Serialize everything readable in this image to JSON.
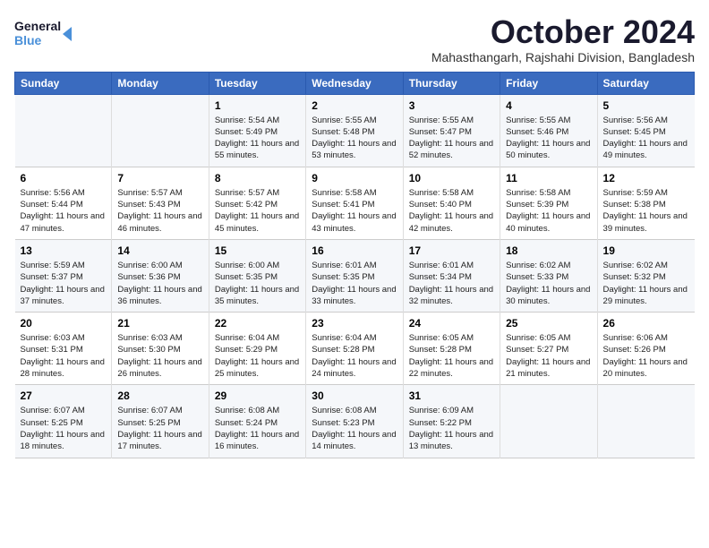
{
  "logo": {
    "line1": "General",
    "line2": "Blue"
  },
  "title": "October 2024",
  "subtitle": "Mahasthangarh, Rajshahi Division, Bangladesh",
  "headers": [
    "Sunday",
    "Monday",
    "Tuesday",
    "Wednesday",
    "Thursday",
    "Friday",
    "Saturday"
  ],
  "weeks": [
    [
      {
        "day": "",
        "text": ""
      },
      {
        "day": "",
        "text": ""
      },
      {
        "day": "1",
        "text": "Sunrise: 5:54 AM\nSunset: 5:49 PM\nDaylight: 11 hours and 55 minutes."
      },
      {
        "day": "2",
        "text": "Sunrise: 5:55 AM\nSunset: 5:48 PM\nDaylight: 11 hours and 53 minutes."
      },
      {
        "day": "3",
        "text": "Sunrise: 5:55 AM\nSunset: 5:47 PM\nDaylight: 11 hours and 52 minutes."
      },
      {
        "day": "4",
        "text": "Sunrise: 5:55 AM\nSunset: 5:46 PM\nDaylight: 11 hours and 50 minutes."
      },
      {
        "day": "5",
        "text": "Sunrise: 5:56 AM\nSunset: 5:45 PM\nDaylight: 11 hours and 49 minutes."
      }
    ],
    [
      {
        "day": "6",
        "text": "Sunrise: 5:56 AM\nSunset: 5:44 PM\nDaylight: 11 hours and 47 minutes."
      },
      {
        "day": "7",
        "text": "Sunrise: 5:57 AM\nSunset: 5:43 PM\nDaylight: 11 hours and 46 minutes."
      },
      {
        "day": "8",
        "text": "Sunrise: 5:57 AM\nSunset: 5:42 PM\nDaylight: 11 hours and 45 minutes."
      },
      {
        "day": "9",
        "text": "Sunrise: 5:58 AM\nSunset: 5:41 PM\nDaylight: 11 hours and 43 minutes."
      },
      {
        "day": "10",
        "text": "Sunrise: 5:58 AM\nSunset: 5:40 PM\nDaylight: 11 hours and 42 minutes."
      },
      {
        "day": "11",
        "text": "Sunrise: 5:58 AM\nSunset: 5:39 PM\nDaylight: 11 hours and 40 minutes."
      },
      {
        "day": "12",
        "text": "Sunrise: 5:59 AM\nSunset: 5:38 PM\nDaylight: 11 hours and 39 minutes."
      }
    ],
    [
      {
        "day": "13",
        "text": "Sunrise: 5:59 AM\nSunset: 5:37 PM\nDaylight: 11 hours and 37 minutes."
      },
      {
        "day": "14",
        "text": "Sunrise: 6:00 AM\nSunset: 5:36 PM\nDaylight: 11 hours and 36 minutes."
      },
      {
        "day": "15",
        "text": "Sunrise: 6:00 AM\nSunset: 5:35 PM\nDaylight: 11 hours and 35 minutes."
      },
      {
        "day": "16",
        "text": "Sunrise: 6:01 AM\nSunset: 5:35 PM\nDaylight: 11 hours and 33 minutes."
      },
      {
        "day": "17",
        "text": "Sunrise: 6:01 AM\nSunset: 5:34 PM\nDaylight: 11 hours and 32 minutes."
      },
      {
        "day": "18",
        "text": "Sunrise: 6:02 AM\nSunset: 5:33 PM\nDaylight: 11 hours and 30 minutes."
      },
      {
        "day": "19",
        "text": "Sunrise: 6:02 AM\nSunset: 5:32 PM\nDaylight: 11 hours and 29 minutes."
      }
    ],
    [
      {
        "day": "20",
        "text": "Sunrise: 6:03 AM\nSunset: 5:31 PM\nDaylight: 11 hours and 28 minutes."
      },
      {
        "day": "21",
        "text": "Sunrise: 6:03 AM\nSunset: 5:30 PM\nDaylight: 11 hours and 26 minutes."
      },
      {
        "day": "22",
        "text": "Sunrise: 6:04 AM\nSunset: 5:29 PM\nDaylight: 11 hours and 25 minutes."
      },
      {
        "day": "23",
        "text": "Sunrise: 6:04 AM\nSunset: 5:28 PM\nDaylight: 11 hours and 24 minutes."
      },
      {
        "day": "24",
        "text": "Sunrise: 6:05 AM\nSunset: 5:28 PM\nDaylight: 11 hours and 22 minutes."
      },
      {
        "day": "25",
        "text": "Sunrise: 6:05 AM\nSunset: 5:27 PM\nDaylight: 11 hours and 21 minutes."
      },
      {
        "day": "26",
        "text": "Sunrise: 6:06 AM\nSunset: 5:26 PM\nDaylight: 11 hours and 20 minutes."
      }
    ],
    [
      {
        "day": "27",
        "text": "Sunrise: 6:07 AM\nSunset: 5:25 PM\nDaylight: 11 hours and 18 minutes."
      },
      {
        "day": "28",
        "text": "Sunrise: 6:07 AM\nSunset: 5:25 PM\nDaylight: 11 hours and 17 minutes."
      },
      {
        "day": "29",
        "text": "Sunrise: 6:08 AM\nSunset: 5:24 PM\nDaylight: 11 hours and 16 minutes."
      },
      {
        "day": "30",
        "text": "Sunrise: 6:08 AM\nSunset: 5:23 PM\nDaylight: 11 hours and 14 minutes."
      },
      {
        "day": "31",
        "text": "Sunrise: 6:09 AM\nSunset: 5:22 PM\nDaylight: 11 hours and 13 minutes."
      },
      {
        "day": "",
        "text": ""
      },
      {
        "day": "",
        "text": ""
      }
    ]
  ]
}
